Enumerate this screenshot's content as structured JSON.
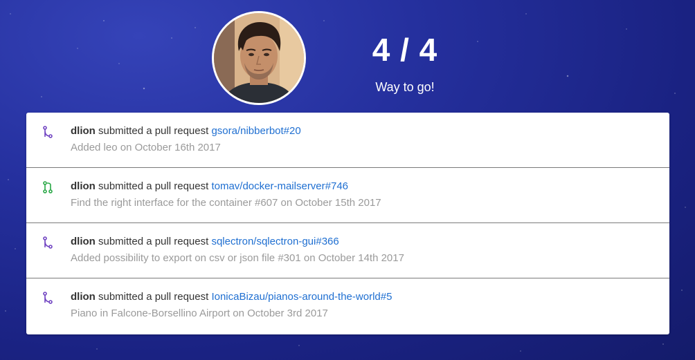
{
  "header": {
    "score": "4 / 4",
    "message": "Way to go!"
  },
  "colors": {
    "link": "#1f6fd1",
    "icon_purple": "#6f42c1",
    "icon_green": "#28a745",
    "background": "#25309e"
  },
  "feed": [
    {
      "user": "dlion",
      "action": "submitted a pull request",
      "repo": "gsora/nibberbot#20",
      "detail": "Added leo on October 16th 2017",
      "icon": "git-merge-icon"
    },
    {
      "user": "dlion",
      "action": "submitted a pull request",
      "repo": "tomav/docker-mailserver#746",
      "detail": "Find the right interface for the container #607 on October 15th 2017",
      "icon": "git-pull-request-icon"
    },
    {
      "user": "dlion",
      "action": "submitted a pull request",
      "repo": "sqlectron/sqlectron-gui#366",
      "detail": "Added possibility to export on csv or json file #301 on October 14th 2017",
      "icon": "git-merge-icon"
    },
    {
      "user": "dlion",
      "action": "submitted a pull request",
      "repo": "IonicaBizau/pianos-around-the-world#5",
      "detail": "Piano in Falcone-Borsellino Airport on October 3rd 2017",
      "icon": "git-merge-icon"
    }
  ]
}
